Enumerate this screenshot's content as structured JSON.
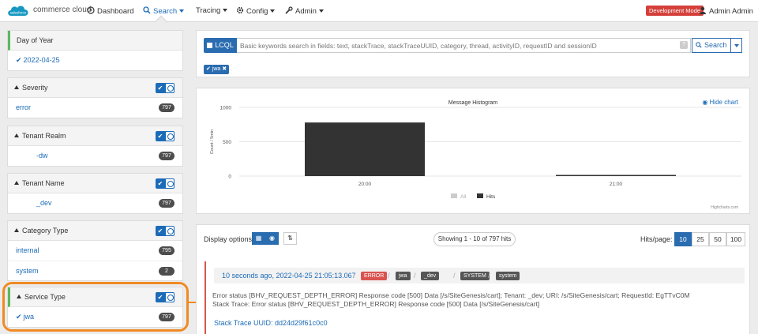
{
  "nav": {
    "brand_logo": "salesforce",
    "brand": "commerce cloud",
    "dashboard": "Dashboard",
    "search": "Search",
    "tracing": "Tracing",
    "config": "Config",
    "admin": "Admin",
    "dev_mode": "Development Mode",
    "user": "Admin Admin"
  },
  "facets": {
    "day_of_year": {
      "title": "Day of Year",
      "value": "2022-04-25"
    },
    "severity": {
      "title": "Severity",
      "value": "error",
      "count": "797"
    },
    "tenant_realm": {
      "title": "Tenant Realm",
      "value": "-dw",
      "count": "797"
    },
    "tenant_name": {
      "title": "Tenant Name",
      "value": "_dev",
      "count": "797"
    },
    "category_type": {
      "title": "Category Type",
      "items": [
        {
          "value": "internal",
          "count": "795"
        },
        {
          "value": "system",
          "count": "2"
        }
      ]
    },
    "service_type": {
      "title": "Service Type",
      "value": "jwa",
      "count": "797"
    }
  },
  "callout": "1",
  "search": {
    "lcql": "LCQL",
    "placeholder": "Basic keywords search in fields: text, stackTrace, stackTraceUUID, category, thread, activityID, requestID and sessionID",
    "help": "?",
    "button": "Search",
    "tag": "jwa"
  },
  "histogram": {
    "hide_chart": "Hide chart",
    "credit": "Highcharts.com"
  },
  "chart_data": {
    "type": "bar",
    "title": "Message Histogram",
    "ylabel": "Count / 5min",
    "xlabel": "",
    "categories": [
      "20:00",
      "21:00"
    ],
    "x_ticks": [
      "20:00",
      "21:00"
    ],
    "y_ticks": [
      0,
      500,
      1000
    ],
    "ylim": [
      0,
      1000
    ],
    "series": [
      {
        "name": "All",
        "values": [
          0,
          0
        ],
        "color": "#cccccc"
      },
      {
        "name": "Hits",
        "values": [
          780,
          17
        ],
        "color": "#333333"
      }
    ],
    "legend": "bottom-center",
    "grid": true
  },
  "results": {
    "display_label": "Display options:",
    "showing": "Showing 1 - 10 of 797 hits",
    "hits_label": "Hits/page:",
    "page_sizes": [
      "10",
      "25",
      "50",
      "100"
    ],
    "entry": {
      "time": "10 seconds ago, 2022-04-25 21:05:13.067",
      "labels": [
        "ERROR",
        "jwa",
        "_dev",
        "SYSTEM",
        "system"
      ],
      "line1": "Error status [BHV_REQUEST_DEPTH_ERROR] Response code [500] Data [/s/SiteGenesis/cart]; Tenant:          _dev; URI:  /s/SiteGenesis/cart; RequestId: EgTTvC0M",
      "line2": "Stack Trace: Error status [BHV_REQUEST_DEPTH_ERROR] Response code [500] Data [/s/SiteGenesis/cart]",
      "stack_uuid": "Stack Trace UUID: dd24d29f61c0c0"
    }
  }
}
